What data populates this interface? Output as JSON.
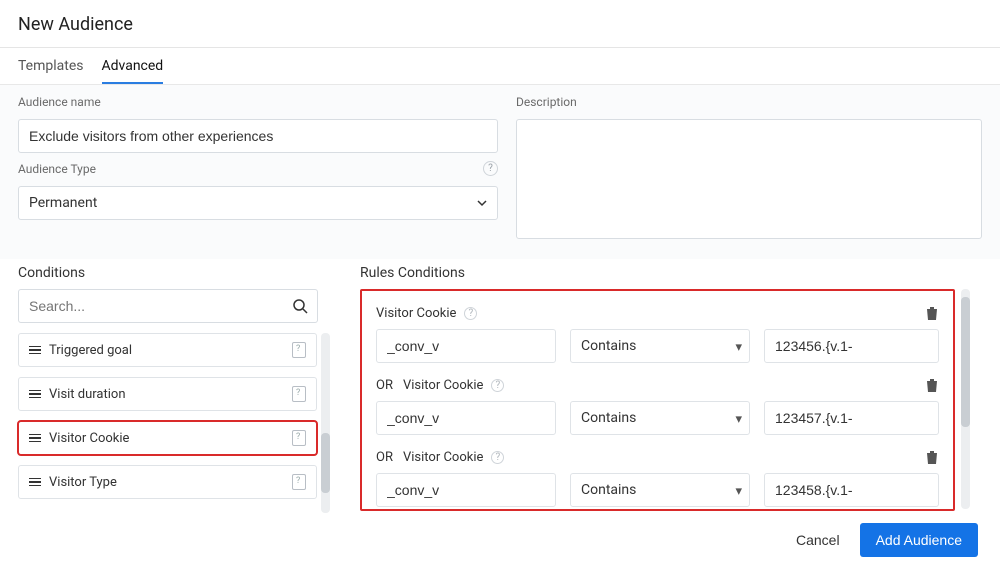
{
  "header": {
    "title": "New Audience"
  },
  "tabs": [
    {
      "label": "Templates",
      "active": false
    },
    {
      "label": "Advanced",
      "active": true
    }
  ],
  "form": {
    "name_label": "Audience name",
    "name_value": "Exclude visitors from other experiences",
    "desc_label": "Description",
    "desc_value": "",
    "type_label": "Audience Type",
    "type_value": "Permanent"
  },
  "conditions": {
    "title": "Conditions",
    "search_placeholder": "Search...",
    "items": [
      {
        "label": "Triggered goal",
        "highlighted": false
      },
      {
        "label": "Visit duration",
        "highlighted": false
      },
      {
        "label": "Visitor Cookie",
        "highlighted": true
      },
      {
        "label": "Visitor Type",
        "highlighted": false
      }
    ]
  },
  "rules": {
    "title": "Rules Conditions",
    "blocks": [
      {
        "prefix": "",
        "head": "Visitor Cookie",
        "cookie": "_conv_v",
        "op": "Contains",
        "val": "123456.{v.1-"
      },
      {
        "prefix": "OR",
        "head": "Visitor Cookie",
        "cookie": "_conv_v",
        "op": "Contains",
        "val": "123457.{v.1-"
      },
      {
        "prefix": "OR",
        "head": "Visitor Cookie",
        "cookie": "_conv_v",
        "op": "Contains",
        "val": "123458.{v.1-"
      }
    ]
  },
  "footer": {
    "cancel": "Cancel",
    "submit": "Add Audience"
  }
}
